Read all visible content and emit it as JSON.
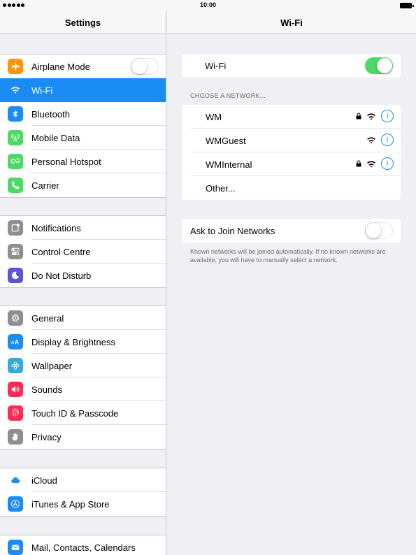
{
  "status_bar": {
    "time": "10:00"
  },
  "sidebar": {
    "title": "Settings",
    "groups": [
      [
        {
          "label": "Airplane Mode",
          "icon": "airplane-icon",
          "color": "#ff9500",
          "toggle": false
        },
        {
          "label": "Wi-Fi",
          "icon": "wifi-icon",
          "color": "#1a8cf4",
          "selected": true
        },
        {
          "label": "Bluetooth",
          "icon": "bluetooth-icon",
          "color": "#1a8cf4"
        },
        {
          "label": "Mobile Data",
          "icon": "antenna-icon",
          "color": "#4cd964"
        },
        {
          "label": "Personal Hotspot",
          "icon": "hotspot-icon",
          "color": "#4cd964"
        },
        {
          "label": "Carrier",
          "icon": "phone-icon",
          "color": "#4cd964"
        }
      ],
      [
        {
          "label": "Notifications",
          "icon": "notifications-icon",
          "color": "#8e8e93"
        },
        {
          "label": "Control Centre",
          "icon": "control-centre-icon",
          "color": "#8e8e93"
        },
        {
          "label": "Do Not Disturb",
          "icon": "moon-icon",
          "color": "#5856d6"
        }
      ],
      [
        {
          "label": "General",
          "icon": "gear-icon",
          "color": "#8e8e93"
        },
        {
          "label": "Display & Brightness",
          "icon": "text-size-icon",
          "color": "#1a8cf4"
        },
        {
          "label": "Wallpaper",
          "icon": "wallpaper-icon",
          "color": "#34aadc"
        },
        {
          "label": "Sounds",
          "icon": "speaker-icon",
          "color": "#ff2d55"
        },
        {
          "label": "Touch ID & Passcode",
          "icon": "fingerprint-icon",
          "color": "#ff2d55"
        },
        {
          "label": "Privacy",
          "icon": "hand-icon",
          "color": "#8e8e93"
        }
      ],
      [
        {
          "label": "iCloud",
          "icon": "cloud-icon",
          "color": "#ffffff"
        },
        {
          "label": "iTunes & App Store",
          "icon": "app-store-icon",
          "color": "#1a8cf4"
        }
      ],
      [
        {
          "label": "Mail, Contacts, Calendars",
          "icon": "mail-icon",
          "color": "#1a8cf4"
        }
      ]
    ]
  },
  "detail": {
    "title": "Wi-Fi",
    "wifi_label": "Wi-Fi",
    "wifi_on": true,
    "choose_label": "CHOOSE A NETWORK...",
    "networks": [
      {
        "name": "WM",
        "locked": true
      },
      {
        "name": "WMGuest",
        "locked": false
      },
      {
        "name": "WMInternal",
        "locked": true
      }
    ],
    "other_label": "Other...",
    "ask_label": "Ask to Join Networks",
    "ask_on": false,
    "footnote": "Known networks will be joined automatically. If no known networks are available, you will have to manually select a network."
  },
  "colors": {
    "accent": "#1a8cf4",
    "toggle_on": "#4cd964"
  }
}
